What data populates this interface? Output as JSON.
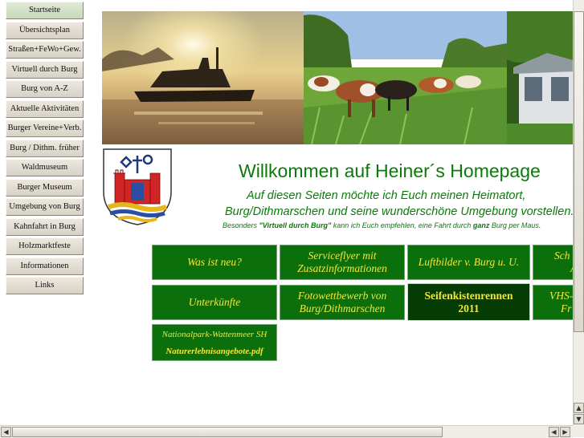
{
  "nav": {
    "items": [
      {
        "label": "Startseite"
      },
      {
        "label": "Übersichtsplan"
      },
      {
        "label": "Straßen+FeWo+Gew."
      },
      {
        "label": "Virtuell durch Burg"
      },
      {
        "label": "Burg von A-Z"
      },
      {
        "label": "Aktuelle Aktivitäten"
      },
      {
        "label": "Burger Vereine+Verb."
      },
      {
        "label": "Burg / Dithm. früher"
      },
      {
        "label": "Waldmuseum"
      },
      {
        "label": "Burger Museum"
      },
      {
        "label": "Umgebung von Burg"
      },
      {
        "label": "Kahnfahrt in Burg"
      },
      {
        "label": "Holzmarktfeste"
      },
      {
        "label": "Informationen"
      },
      {
        "label": "Links"
      }
    ]
  },
  "main": {
    "welcome": "Willkommen auf Heiner´s Homepage",
    "intro_line1": "Auf diesen Seiten möchte ich Euch meinen Heimatort,",
    "intro_line2": "Burg/Dithmarschen und seine wunderschöne Umgebung vorstellen.",
    "intro_line3_a": "Besonders ",
    "intro_line3_b": "\"Virtuell durch Burg\"",
    "intro_line3_c": " kann ich Euch empfehlen, eine Fahrt durch ",
    "intro_line3_d": "ganz",
    "intro_line3_e": " Burg per Maus."
  },
  "tiles": {
    "was_ist_neu": "Was ist neu?",
    "serviceflyer_1": "Serviceflyer mit",
    "serviceflyer_2": "Zusatzinformationen",
    "luftbilder": "Luftbilder v. Burg u. U.",
    "partial_top_1": "Sch",
    "partial_top_2": "A",
    "unterkuenfte": "Unterkünfte",
    "foto_1": "Fotowettbewerb von",
    "foto_2": "Burg/Dithmarschen",
    "seifen_1": "Seifenkistenrennen",
    "seifen_2": "2011",
    "vhs_1": "VHS-",
    "vhs_2": "Fr",
    "national_1": "Nationalpark-Wattenmeer SH",
    "national_2": "Naturerlebnisangebote.pdf"
  },
  "colors": {
    "heading_green": "#0b7a0b",
    "tile_green": "#0b6f0b",
    "tile_dark": "#053c05",
    "tile_text": "#f2e63a"
  }
}
